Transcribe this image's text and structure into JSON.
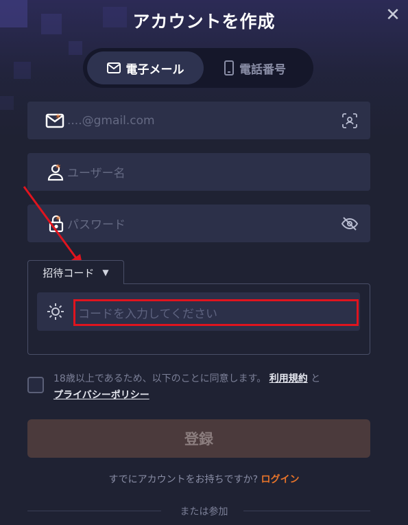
{
  "header": {
    "title": "アカウントを作成",
    "close_icon": "close-icon"
  },
  "tabs": {
    "email": "電子メール",
    "phone": "電話番号"
  },
  "fields": {
    "email": {
      "placeholder": "....@gmail.com",
      "icon": "mail-icon",
      "required_mark": "*",
      "trail_icon": "scan-face-icon"
    },
    "username": {
      "placeholder": "ユーザー名",
      "icon": "user-icon",
      "required_mark": "*"
    },
    "password": {
      "placeholder": "パスワード",
      "icon": "lock-icon",
      "required_mark": "*",
      "trail_icon": "eye-off-icon"
    }
  },
  "invite": {
    "tab_label": "招待コード",
    "placeholder": "コードを入力してください",
    "icon": "sun-icon"
  },
  "agreement": {
    "text": "18歳以上であるため、以下のことに同意します。",
    "terms": "利用規約",
    "and": "と",
    "privacy": "プライバシーポリシー"
  },
  "register_label": "登録",
  "login_prompt": {
    "text": "すでにアカウントをお持ちですか?",
    "link": "ログイン"
  },
  "or_join": "または参加",
  "colors": {
    "accent": "#e8742a",
    "highlight": "#e0141e",
    "background": "#1f2233",
    "field": "#2c3049"
  }
}
